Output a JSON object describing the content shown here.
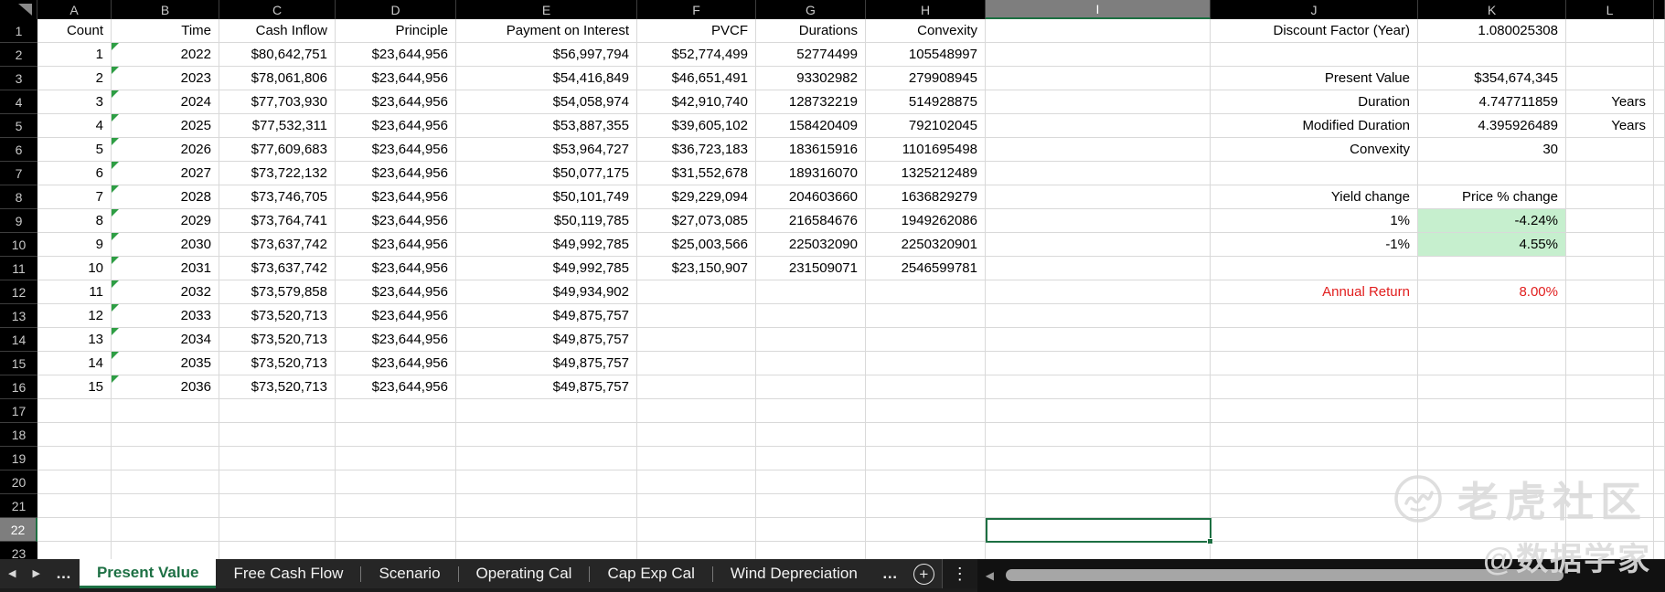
{
  "sheet": {
    "name": "spreadsheet",
    "col_ids": [
      "A",
      "B",
      "C",
      "D",
      "E",
      "F",
      "G",
      "H",
      "I",
      "J",
      "K",
      "L",
      ""
    ],
    "selected_column": "I",
    "selected_row": 22,
    "row_count": 23,
    "rows": [
      {
        "n": 1,
        "cells": [
          {
            "c": "A",
            "v": "Count"
          },
          {
            "c": "B",
            "v": "Time"
          },
          {
            "c": "C",
            "v": "Cash Inflow"
          },
          {
            "c": "D",
            "v": "Principle"
          },
          {
            "c": "E",
            "v": "Payment on Interest"
          },
          {
            "c": "F",
            "v": "PVCF"
          },
          {
            "c": "G",
            "v": "Durations"
          },
          {
            "c": "H",
            "v": "Convexity"
          },
          {
            "c": "J",
            "v": "Discount Factor (Year)"
          },
          {
            "c": "K",
            "v": "1.080025308"
          }
        ]
      },
      {
        "n": 2,
        "cells": [
          {
            "c": "A",
            "v": "1"
          },
          {
            "c": "B",
            "v": "2022",
            "tri": true
          },
          {
            "c": "C",
            "v": "$80,642,751"
          },
          {
            "c": "D",
            "v": "$23,644,956"
          },
          {
            "c": "E",
            "v": "$56,997,794"
          },
          {
            "c": "F",
            "v": "$52,774,499"
          },
          {
            "c": "G",
            "v": "52774499"
          },
          {
            "c": "H",
            "v": "105548997"
          }
        ]
      },
      {
        "n": 3,
        "cells": [
          {
            "c": "A",
            "v": "2"
          },
          {
            "c": "B",
            "v": "2023",
            "tri": true
          },
          {
            "c": "C",
            "v": "$78,061,806"
          },
          {
            "c": "D",
            "v": "$23,644,956"
          },
          {
            "c": "E",
            "v": "$54,416,849"
          },
          {
            "c": "F",
            "v": "$46,651,491"
          },
          {
            "c": "G",
            "v": "93302982"
          },
          {
            "c": "H",
            "v": "279908945"
          },
          {
            "c": "J",
            "v": "Present Value"
          },
          {
            "c": "K",
            "v": "$354,674,345"
          }
        ]
      },
      {
        "n": 4,
        "cells": [
          {
            "c": "A",
            "v": "3"
          },
          {
            "c": "B",
            "v": "2024",
            "tri": true
          },
          {
            "c": "C",
            "v": "$77,703,930"
          },
          {
            "c": "D",
            "v": "$23,644,956"
          },
          {
            "c": "E",
            "v": "$54,058,974"
          },
          {
            "c": "F",
            "v": "$42,910,740"
          },
          {
            "c": "G",
            "v": "128732219"
          },
          {
            "c": "H",
            "v": "514928875"
          },
          {
            "c": "J",
            "v": "Duration"
          },
          {
            "c": "K",
            "v": "4.747711859"
          },
          {
            "c": "L",
            "v": "Years"
          }
        ]
      },
      {
        "n": 5,
        "cells": [
          {
            "c": "A",
            "v": "4"
          },
          {
            "c": "B",
            "v": "2025",
            "tri": true
          },
          {
            "c": "C",
            "v": "$77,532,311"
          },
          {
            "c": "D",
            "v": "$23,644,956"
          },
          {
            "c": "E",
            "v": "$53,887,355"
          },
          {
            "c": "F",
            "v": "$39,605,102"
          },
          {
            "c": "G",
            "v": "158420409"
          },
          {
            "c": "H",
            "v": "792102045"
          },
          {
            "c": "J",
            "v": "Modified Duration"
          },
          {
            "c": "K",
            "v": "4.395926489"
          },
          {
            "c": "L",
            "v": "Years"
          }
        ]
      },
      {
        "n": 6,
        "cells": [
          {
            "c": "A",
            "v": "5"
          },
          {
            "c": "B",
            "v": "2026",
            "tri": true
          },
          {
            "c": "C",
            "v": "$77,609,683"
          },
          {
            "c": "D",
            "v": "$23,644,956"
          },
          {
            "c": "E",
            "v": "$53,964,727"
          },
          {
            "c": "F",
            "v": "$36,723,183"
          },
          {
            "c": "G",
            "v": "183615916"
          },
          {
            "c": "H",
            "v": "1101695498"
          },
          {
            "c": "J",
            "v": "Convexity"
          },
          {
            "c": "K",
            "v": "30"
          }
        ]
      },
      {
        "n": 7,
        "cells": [
          {
            "c": "A",
            "v": "6"
          },
          {
            "c": "B",
            "v": "2027",
            "tri": true
          },
          {
            "c": "C",
            "v": "$73,722,132"
          },
          {
            "c": "D",
            "v": "$23,644,956"
          },
          {
            "c": "E",
            "v": "$50,077,175"
          },
          {
            "c": "F",
            "v": "$31,552,678"
          },
          {
            "c": "G",
            "v": "189316070"
          },
          {
            "c": "H",
            "v": "1325212489"
          }
        ]
      },
      {
        "n": 8,
        "cells": [
          {
            "c": "A",
            "v": "7"
          },
          {
            "c": "B",
            "v": "2028",
            "tri": true
          },
          {
            "c": "C",
            "v": "$73,746,705"
          },
          {
            "c": "D",
            "v": "$23,644,956"
          },
          {
            "c": "E",
            "v": "$50,101,749"
          },
          {
            "c": "F",
            "v": "$29,229,094"
          },
          {
            "c": "G",
            "v": "204603660"
          },
          {
            "c": "H",
            "v": "1636829279"
          },
          {
            "c": "J",
            "v": "Yield change"
          },
          {
            "c": "K",
            "v": "Price % change"
          }
        ]
      },
      {
        "n": 9,
        "cells": [
          {
            "c": "A",
            "v": "8"
          },
          {
            "c": "B",
            "v": "2029",
            "tri": true
          },
          {
            "c": "C",
            "v": "$73,764,741"
          },
          {
            "c": "D",
            "v": "$23,644,956"
          },
          {
            "c": "E",
            "v": "$50,119,785"
          },
          {
            "c": "F",
            "v": "$27,073,085"
          },
          {
            "c": "G",
            "v": "216584676"
          },
          {
            "c": "H",
            "v": "1949262086"
          },
          {
            "c": "J",
            "v": "1%"
          },
          {
            "c": "K",
            "v": "-4.24%",
            "s": "green-fill"
          }
        ]
      },
      {
        "n": 10,
        "cells": [
          {
            "c": "A",
            "v": "9"
          },
          {
            "c": "B",
            "v": "2030",
            "tri": true
          },
          {
            "c": "C",
            "v": "$73,637,742"
          },
          {
            "c": "D",
            "v": "$23,644,956"
          },
          {
            "c": "E",
            "v": "$49,992,785"
          },
          {
            "c": "F",
            "v": "$25,003,566"
          },
          {
            "c": "G",
            "v": "225032090"
          },
          {
            "c": "H",
            "v": "2250320901"
          },
          {
            "c": "J",
            "v": "-1%"
          },
          {
            "c": "K",
            "v": "4.55%",
            "s": "green-fill"
          }
        ]
      },
      {
        "n": 11,
        "cells": [
          {
            "c": "A",
            "v": "10"
          },
          {
            "c": "B",
            "v": "2031",
            "tri": true
          },
          {
            "c": "C",
            "v": "$73,637,742"
          },
          {
            "c": "D",
            "v": "$23,644,956"
          },
          {
            "c": "E",
            "v": "$49,992,785"
          },
          {
            "c": "F",
            "v": "$23,150,907"
          },
          {
            "c": "G",
            "v": "231509071"
          },
          {
            "c": "H",
            "v": "2546599781"
          }
        ]
      },
      {
        "n": 12,
        "cells": [
          {
            "c": "A",
            "v": "11"
          },
          {
            "c": "B",
            "v": "2032",
            "tri": true
          },
          {
            "c": "C",
            "v": "$73,579,858"
          },
          {
            "c": "D",
            "v": "$23,644,956"
          },
          {
            "c": "E",
            "v": "$49,934,902"
          },
          {
            "c": "J",
            "v": "Annual Return",
            "s": "red"
          },
          {
            "c": "K",
            "v": "8.00%",
            "s": "red"
          }
        ]
      },
      {
        "n": 13,
        "cells": [
          {
            "c": "A",
            "v": "12"
          },
          {
            "c": "B",
            "v": "2033",
            "tri": true
          },
          {
            "c": "C",
            "v": "$73,520,713"
          },
          {
            "c": "D",
            "v": "$23,644,956"
          },
          {
            "c": "E",
            "v": "$49,875,757"
          }
        ]
      },
      {
        "n": 14,
        "cells": [
          {
            "c": "A",
            "v": "13"
          },
          {
            "c": "B",
            "v": "2034",
            "tri": true
          },
          {
            "c": "C",
            "v": "$73,520,713"
          },
          {
            "c": "D",
            "v": "$23,644,956"
          },
          {
            "c": "E",
            "v": "$49,875,757"
          }
        ]
      },
      {
        "n": 15,
        "cells": [
          {
            "c": "A",
            "v": "14"
          },
          {
            "c": "B",
            "v": "2035",
            "tri": true
          },
          {
            "c": "C",
            "v": "$73,520,713"
          },
          {
            "c": "D",
            "v": "$23,644,956"
          },
          {
            "c": "E",
            "v": "$49,875,757"
          }
        ]
      },
      {
        "n": 16,
        "cells": [
          {
            "c": "A",
            "v": "15"
          },
          {
            "c": "B",
            "v": "2036",
            "tri": true
          },
          {
            "c": "C",
            "v": "$73,520,713"
          },
          {
            "c": "D",
            "v": "$23,644,956"
          },
          {
            "c": "E",
            "v": "$49,875,757"
          }
        ]
      },
      {
        "n": 17,
        "cells": []
      },
      {
        "n": 18,
        "cells": []
      },
      {
        "n": 19,
        "cells": []
      },
      {
        "n": 20,
        "cells": []
      },
      {
        "n": 21,
        "cells": []
      },
      {
        "n": 22,
        "cells": []
      },
      {
        "n": 23,
        "cells": []
      }
    ]
  },
  "tabbar": {
    "nav_prev_icon": "◀",
    "nav_next_icon": "▶",
    "more_tabs_icon": "…",
    "tabs": [
      {
        "label": "Present Value",
        "active": true
      },
      {
        "label": "Free Cash Flow",
        "active": false
      },
      {
        "label": "Scenario",
        "active": false
      },
      {
        "label": "Operating Cal",
        "active": false
      },
      {
        "label": "Cap Exp Cal",
        "active": false
      },
      {
        "label": "Wind Depreciation",
        "active": false
      }
    ],
    "overflow_icon": "…",
    "add_sheet_icon": "+",
    "sheet_menu_icon": "⋮",
    "scroll_left_icon": "◀"
  },
  "watermark": {
    "brand_text": "老虎社区",
    "handle_text": "@数据学家"
  },
  "colors": {
    "accent_green": "#1d6f42",
    "highlight_fill": "#c6efce",
    "alert_red": "#e11e1e",
    "header_bg": "#000000",
    "selected_header_bg": "#7e7e7e"
  }
}
